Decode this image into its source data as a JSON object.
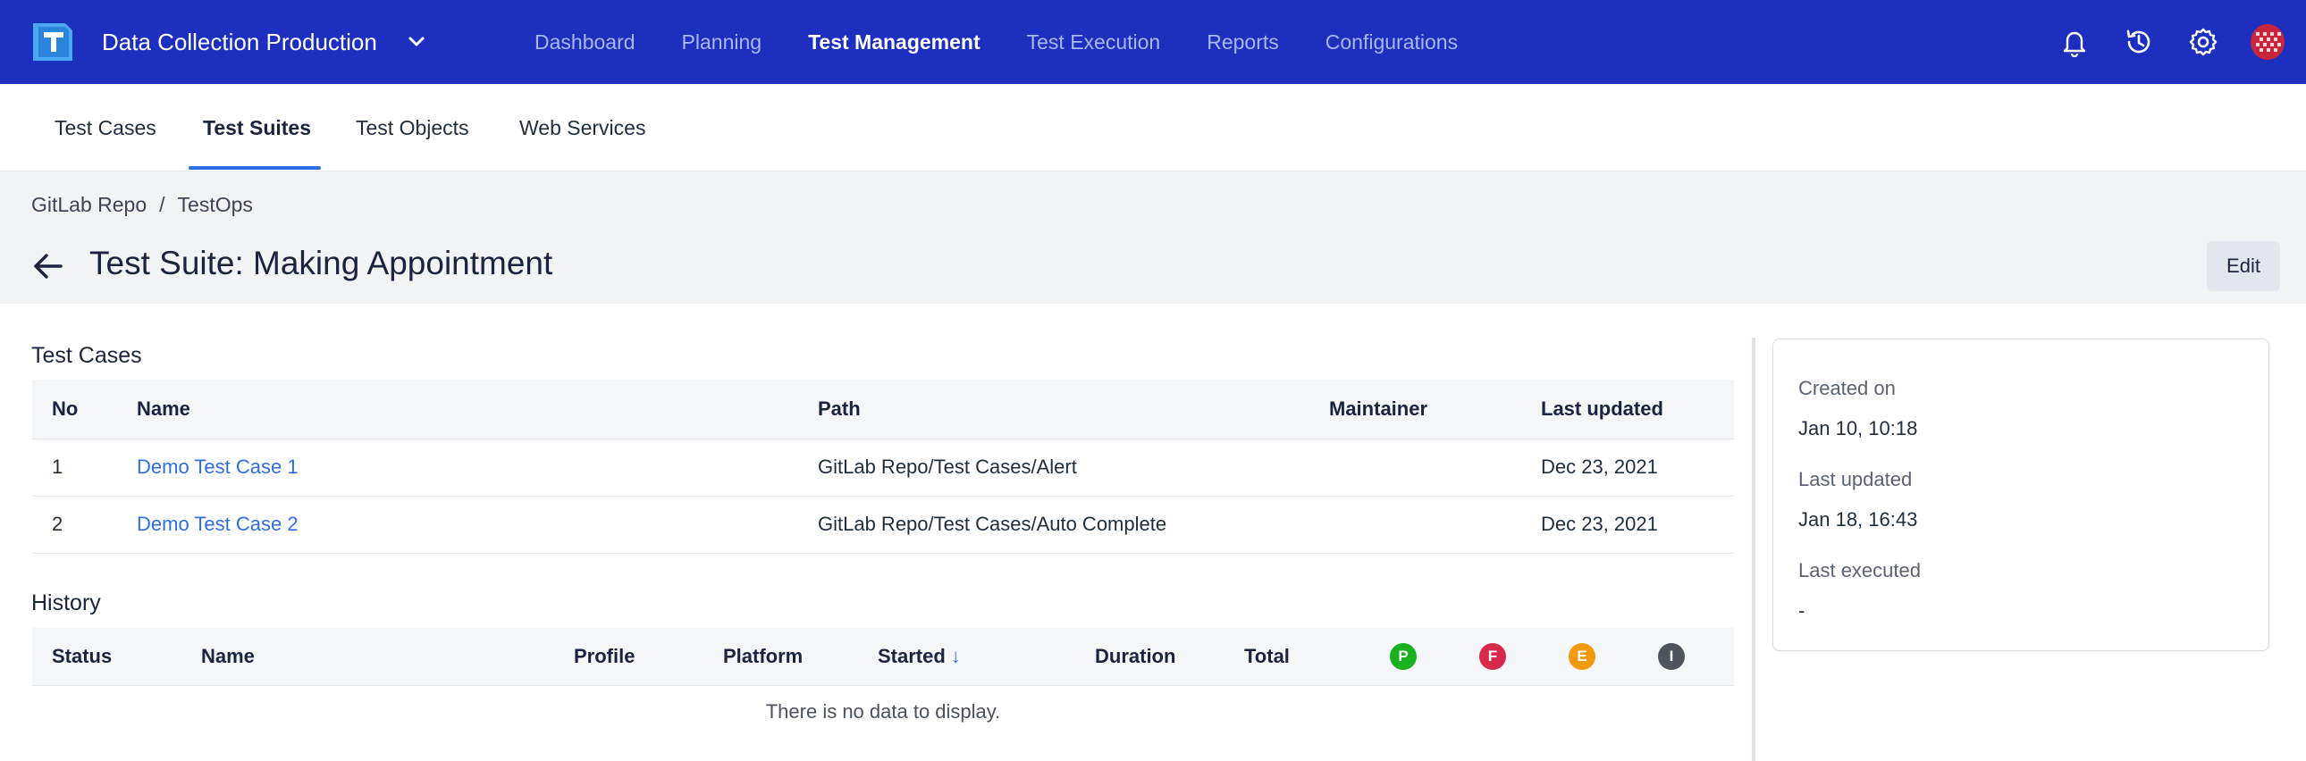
{
  "topbar": {
    "project_name": "Data Collection Production",
    "nav": [
      {
        "label": "Dashboard"
      },
      {
        "label": "Planning"
      },
      {
        "label": "Test Management",
        "active": true
      },
      {
        "label": "Test Execution"
      },
      {
        "label": "Reports"
      },
      {
        "label": "Configurations"
      }
    ],
    "icons": [
      "bell-icon",
      "history-icon",
      "gear-icon",
      "avatar"
    ],
    "colors": {
      "bar": "#1d2fbf",
      "active": "#ffffff",
      "inactive": "#a9b7f3"
    }
  },
  "subtabs": [
    {
      "label": "Test Cases"
    },
    {
      "label": "Test Suites",
      "active": true
    },
    {
      "label": "Test Objects"
    },
    {
      "label": "Web Services"
    }
  ],
  "breadcrumb": {
    "items": [
      "GitLab Repo",
      "TestOps"
    ],
    "separator": "/"
  },
  "page": {
    "title": "Test Suite: Making Appointment",
    "edit_label": "Edit"
  },
  "test_cases": {
    "title": "Test Cases",
    "columns": [
      "No",
      "Name",
      "Path",
      "Maintainer",
      "Last updated"
    ],
    "rows": [
      {
        "no": "1",
        "name": "Demo Test Case 1",
        "path": "GitLab Repo/Test Cases/Alert",
        "maintainer": "",
        "updated": "Dec 23, 2021"
      },
      {
        "no": "2",
        "name": "Demo Test Case 2",
        "path": "GitLab Repo/Test Cases/Auto Complete",
        "maintainer": "",
        "updated": "Dec 23, 2021"
      }
    ]
  },
  "history": {
    "title": "History",
    "columns": [
      "Status",
      "Name",
      "Profile",
      "Platform",
      "Started",
      "Duration",
      "Total"
    ],
    "sort_indicator": "↓",
    "status_badges": [
      {
        "letter": "P",
        "color": "#19b21f"
      },
      {
        "letter": "F",
        "color": "#d6294b"
      },
      {
        "letter": "E",
        "color": "#f29a0e"
      },
      {
        "letter": "I",
        "color": "#4e535c"
      }
    ],
    "empty_text": "There is no data to display."
  },
  "info": {
    "created_label": "Created on",
    "created_value": "Jan 10, 10:18",
    "updated_label": "Last updated",
    "updated_value": "Jan 18, 16:43",
    "executed_label": "Last executed",
    "executed_value": "-"
  }
}
